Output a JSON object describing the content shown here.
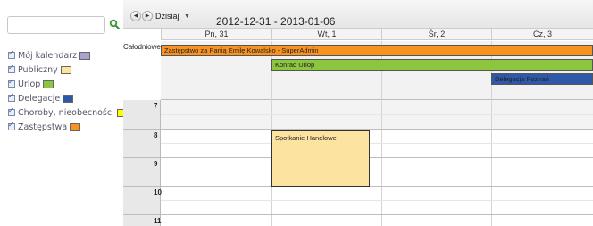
{
  "sidebar": {
    "search": {
      "value": "",
      "placeholder": ""
    },
    "calendars": [
      {
        "label": "Mój kalendarz",
        "checked": true,
        "color": "#a9a3cc"
      },
      {
        "label": "Publiczny",
        "checked": true,
        "color": "#fce39f"
      },
      {
        "label": "Urlop",
        "checked": true,
        "color": "#8cc63f"
      },
      {
        "label": "Delegacje",
        "checked": true,
        "color": "#2f59a8"
      },
      {
        "label": "Choroby, nieobecności",
        "checked": true,
        "color": "#ffff00"
      },
      {
        "label": "Zastępstwa",
        "checked": true,
        "color": "#f7931e"
      }
    ]
  },
  "toolbar": {
    "prev_icon": "◀",
    "next_icon": "▶",
    "today_label": "Dzisiaj",
    "dropdown_icon": "▼",
    "date_range": "2012-12-31 - 2013-01-06"
  },
  "calendar": {
    "days": [
      "Pn, 31",
      "Wt, 1",
      "Śr, 2",
      "Cz, 3"
    ],
    "allday_label": "Całodniowe",
    "allday_events": [
      {
        "title": "Zastępstwo za Panią Emilę Kowalsko - SuperAdmin",
        "color": "#f7931e"
      },
      {
        "title": "Konrad Urlop",
        "color": "#8cc63f"
      },
      {
        "title": "Delegacja Poznań",
        "color": "#2f59a8"
      }
    ],
    "hours": [
      "7",
      "8",
      "9",
      "10",
      "11"
    ],
    "events": [
      {
        "title": "Spotkanie Handlowe",
        "color": "#fce39f"
      }
    ]
  }
}
